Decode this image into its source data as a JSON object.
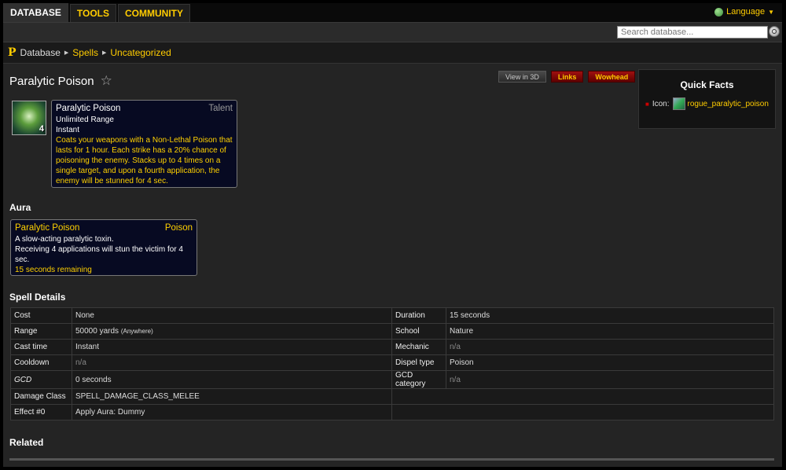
{
  "nav": {
    "tabs": [
      {
        "label": "DATABASE"
      },
      {
        "label": "TOOLS"
      },
      {
        "label": "COMMUNITY"
      }
    ],
    "language": "Language"
  },
  "search": {
    "placeholder": "Search database..."
  },
  "breadcrumb": {
    "logo": "P",
    "items": [
      "Database",
      "Spells",
      "Uncategorized"
    ]
  },
  "page": {
    "title": "Paralytic Poison"
  },
  "buttons": {
    "view3d": "View in 3D",
    "links": "Links",
    "wowhead": "Wowhead"
  },
  "quick_facts": {
    "title": "Quick Facts",
    "icon_label": "Icon:",
    "icon_name": "rogue_paralytic_poison"
  },
  "spell_icon": {
    "stack": "4"
  },
  "tooltip": {
    "name": "Paralytic Poison",
    "type": "Talent",
    "range": "Unlimited Range",
    "cast": "Instant",
    "description": "Coats your weapons with a Non-Lethal Poison that lasts for 1 hour. Each strike has a 20% chance of poisoning the enemy. Stacks up to 4 times on a single target, and upon a fourth application, the enemy will be stunned for 4 sec."
  },
  "aura": {
    "section_title": "Aura",
    "name": "Paralytic Poison",
    "type": "Poison",
    "line1": "A slow-acting paralytic toxin.",
    "line2": "Receiving 4 applications will stun the victim for 4 sec.",
    "remaining": "15 seconds remaining"
  },
  "spell_details": {
    "section_title": "Spell Details",
    "rows": [
      {
        "l1": "Cost",
        "v1": "None",
        "l2": "Duration",
        "v2": "15 seconds"
      },
      {
        "l1": "Range",
        "v1": "50000 yards",
        "v1_note": "(Anywhere)",
        "l2": "School",
        "v2": "Nature"
      },
      {
        "l1": "Cast time",
        "v1": "Instant",
        "l2": "Mechanic",
        "v2": "n/a"
      },
      {
        "l1": "Cooldown",
        "v1": "n/a",
        "l2": "Dispel type",
        "v2": "Poison"
      },
      {
        "l1": "GCD",
        "v1": "0 seconds",
        "l2": "GCD category",
        "v2": "n/a"
      },
      {
        "l1": "Damage Class",
        "v1": "SPELL_DAMAGE_CLASS_MELEE",
        "l2": "",
        "v2": ""
      },
      {
        "l1": "Effect #0",
        "v1": "Apply Aura: Dummy",
        "l2": "",
        "v2": ""
      }
    ]
  },
  "related": {
    "title": "Related"
  },
  "colors": {
    "accent": "#ffcc00",
    "tooltip_bg": "#070a22",
    "gold_text": "#ffd100",
    "red_button": "#a01010"
  }
}
